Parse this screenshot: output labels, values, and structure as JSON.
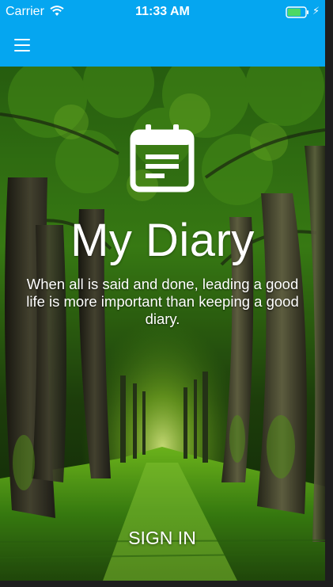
{
  "status_bar": {
    "carrier": "Carrier",
    "time": "11:33 AM",
    "wifi_icon": "wifi-icon",
    "battery_icon": "battery-icon",
    "charging_icon": "charging-bolt-icon",
    "battery_level": 0.75
  },
  "header": {
    "menu_icon": "hamburger-menu-icon",
    "color": "#05a6f0"
  },
  "hero": {
    "icon": "calendar-icon",
    "title": "My Diary",
    "quote": "When all is said and done, leading a good life is more important than keeping a good diary.",
    "background": "forest-path-image"
  },
  "actions": {
    "sign_in_label": "SIGN IN"
  },
  "colors": {
    "accent": "#05a6f0",
    "text": "#ffffff",
    "battery_fill": "#4cd964"
  }
}
